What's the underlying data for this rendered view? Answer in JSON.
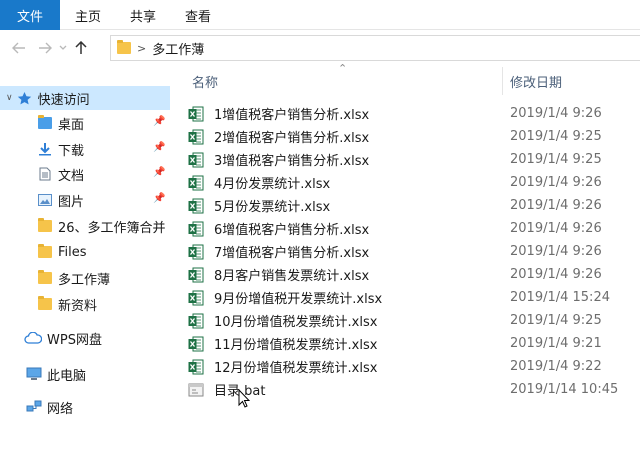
{
  "ribbon": {
    "tabs": [
      "文件",
      "主页",
      "共享",
      "查看"
    ]
  },
  "nav": {
    "back_icon": "arrow-left-icon",
    "forward_icon": "arrow-right-icon",
    "recent_icon": "chevron-down-icon",
    "up_icon": "arrow-up-icon",
    "path": [
      "多工作薄"
    ]
  },
  "sidebar": {
    "items": [
      {
        "label": "快速访问",
        "icon": "star-icon"
      },
      {
        "label": "桌面",
        "icon": "desktop-folder-icon",
        "pinned": true
      },
      {
        "label": "下载",
        "icon": "download-folder-icon",
        "pinned": true
      },
      {
        "label": "文档",
        "icon": "documents-folder-icon",
        "pinned": true
      },
      {
        "label": "图片",
        "icon": "pictures-folder-icon",
        "pinned": true
      },
      {
        "label": "26、多工作簿合并",
        "icon": "folder-icon"
      },
      {
        "label": "Files",
        "icon": "folder-icon"
      },
      {
        "label": "多工作薄",
        "icon": "folder-icon"
      },
      {
        "label": "新资料",
        "icon": "folder-icon"
      },
      {
        "label": "WPS网盘",
        "icon": "cloud-icon"
      },
      {
        "label": "此电脑",
        "icon": "computer-icon"
      },
      {
        "label": "网络",
        "icon": "network-icon"
      }
    ]
  },
  "columns": {
    "name": "名称",
    "modified": "修改日期"
  },
  "files": [
    {
      "name": "1增值税客户销售分析.xlsx",
      "date": "2019/1/4 9:26",
      "type": "xlsx"
    },
    {
      "name": "2增值税客户销售分析.xlsx",
      "date": "2019/1/4 9:25",
      "type": "xlsx"
    },
    {
      "name": "3增值税客户销售分析.xlsx",
      "date": "2019/1/4 9:25",
      "type": "xlsx"
    },
    {
      "name": "4月份发票统计.xlsx",
      "date": "2019/1/4 9:26",
      "type": "xlsx"
    },
    {
      "name": "5月份发票统计.xlsx",
      "date": "2019/1/4 9:26",
      "type": "xlsx"
    },
    {
      "name": "6增值税客户销售分析.xlsx",
      "date": "2019/1/4 9:26",
      "type": "xlsx"
    },
    {
      "name": "7增值税客户销售分析.xlsx",
      "date": "2019/1/4 9:26",
      "type": "xlsx"
    },
    {
      "name": "8月客户销售发票统计.xlsx",
      "date": "2019/1/4 9:26",
      "type": "xlsx"
    },
    {
      "name": "9月份增值税开发票统计.xlsx",
      "date": "2019/1/4 15:24",
      "type": "xlsx"
    },
    {
      "name": "10月份增值税发票统计.xlsx",
      "date": "2019/1/4 9:25",
      "type": "xlsx"
    },
    {
      "name": "11月份增值税发票统计.xlsx",
      "date": "2019/1/4 9:21",
      "type": "xlsx"
    },
    {
      "name": "12月份增值税发票统计.xlsx",
      "date": "2019/1/4 9:22",
      "type": "xlsx"
    },
    {
      "name": "目录.bat",
      "date": "2019/1/14 10:45",
      "type": "bat"
    }
  ],
  "colors": {
    "accent": "#1979ca",
    "selection": "#cce8ff",
    "excel_green": "#1e7145"
  }
}
